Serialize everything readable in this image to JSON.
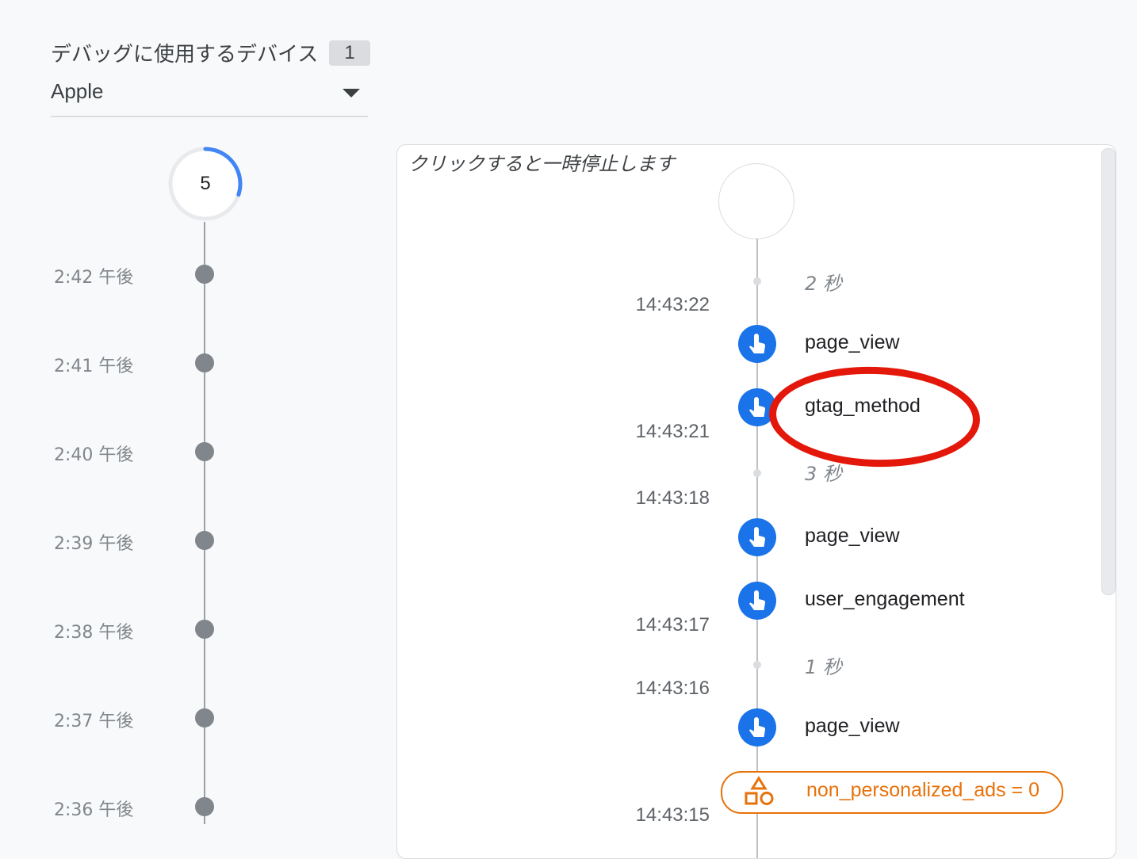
{
  "device": {
    "label": "デバッグに使用するデバイス",
    "count": "1",
    "selected": "Apple"
  },
  "minutes": {
    "counter": "5",
    "counter_progress": 0.3,
    "rows": [
      {
        "label": "2:42 午後"
      },
      {
        "label": "2:41 午後"
      },
      {
        "label": "2:40 午後"
      },
      {
        "label": "2:39 午後"
      },
      {
        "label": "2:38 午後"
      },
      {
        "label": "2:37 午後"
      },
      {
        "label": "2:36 午後"
      }
    ]
  },
  "stream": {
    "pause_hint": "クリックすると一時停止します",
    "gaps": [
      "2 秒",
      "3 秒",
      "1 秒"
    ],
    "timestamps": [
      "14:43:22",
      "14:43:21",
      "14:43:18",
      "14:43:17",
      "14:43:16",
      "14:43:15"
    ],
    "events": [
      {
        "name": "page_view",
        "icon": "touch-icon"
      },
      {
        "name": "gtag_method",
        "icon": "touch-icon"
      },
      {
        "name": "page_view",
        "icon": "touch-icon"
      },
      {
        "name": "user_engagement",
        "icon": "touch-icon"
      },
      {
        "name": "page_view",
        "icon": "touch-icon"
      }
    ],
    "user_property": {
      "text": "non_personalized_ads = 0",
      "icon": "shapes-icon"
    }
  },
  "colors": {
    "event_blue": "#1a73e8",
    "property_orange": "#e8710a",
    "annotation_red": "#e3170a"
  }
}
